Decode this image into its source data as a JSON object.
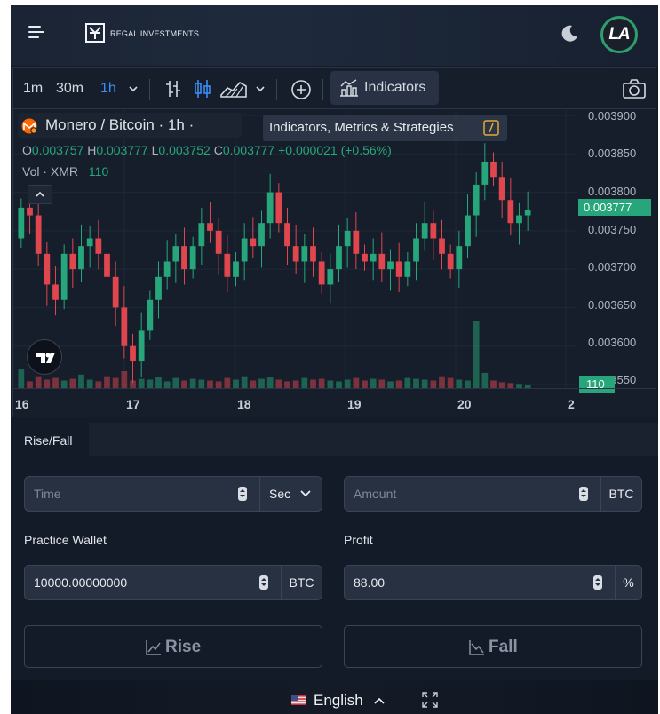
{
  "header": {
    "brand": "REGAL INVESTMENTS",
    "avatar_initials": "LA"
  },
  "toolbar": {
    "intervals": [
      "1m",
      "30m",
      "1h"
    ],
    "active_interval": "1h",
    "indicators_label": "Indicators"
  },
  "chart": {
    "symbol_title": "Monero / Bitcoin · 1h ·",
    "tooltip": "Indicators, Metrics & Strategies",
    "ohlc": {
      "o_label": "O",
      "o": "0.003757",
      "h_label": "H",
      "h": "0.003777",
      "l_label": "L",
      "l": "0.003752",
      "c_label": "C",
      "c": "0.003777",
      "change": "+0.000021 (+0.56%)"
    },
    "volume_label": "Vol · XMR",
    "volume_value": "110",
    "current_price": "0.003777",
    "volume_badge": "110"
  },
  "chart_data": {
    "type": "candlestick",
    "price_ticks": [
      "0.003900",
      "0.003850",
      "0.003800",
      "0.003750",
      "0.003700",
      "0.003650",
      "0.003600",
      "0.003550"
    ],
    "ylim": [
      0.00355,
      0.0039
    ],
    "time_ticks": [
      "16",
      "17",
      "18",
      "19",
      "20",
      "2"
    ],
    "colors": {
      "up": "#26a67a",
      "down": "#e0464d"
    },
    "closes": [
      0.00378,
      0.00377,
      0.00372,
      0.00368,
      0.00366,
      0.00372,
      0.0037,
      0.00373,
      0.00374,
      0.00372,
      0.00369,
      0.00365,
      0.0036,
      0.00358,
      0.00362,
      0.00366,
      0.00369,
      0.00371,
      0.00373,
      0.0037,
      0.00373,
      0.00376,
      0.00375,
      0.00372,
      0.00369,
      0.00371,
      0.00374,
      0.00373,
      0.00376,
      0.0038,
      0.00376,
      0.00373,
      0.00371,
      0.00373,
      0.00371,
      0.00368,
      0.0037,
      0.00373,
      0.00375,
      0.00372,
      0.00371,
      0.00372,
      0.0037,
      0.00371,
      0.00369,
      0.00371,
      0.00374,
      0.00376,
      0.00374,
      0.00372,
      0.0037,
      0.00373,
      0.00377,
      0.00381,
      0.00384,
      0.00382,
      0.00379,
      0.00376,
      0.00377,
      0.003777
    ],
    "volumes": [
      22,
      8,
      14,
      10,
      12,
      9,
      11,
      16,
      10,
      8,
      14,
      12,
      20,
      9,
      11,
      10,
      13,
      8,
      12,
      9,
      11,
      10,
      9,
      8,
      12,
      10,
      14,
      9,
      11,
      13,
      10,
      8,
      9,
      12,
      10,
      11,
      9,
      8,
      10,
      12,
      9,
      11,
      10,
      8,
      9,
      12,
      11,
      10,
      9,
      14,
      12,
      10,
      9,
      80,
      18,
      9,
      7,
      6,
      5,
      4
    ]
  },
  "trade": {
    "tab": "Rise/Fall",
    "time_placeholder": "Time",
    "time_unit": "Sec",
    "amount_placeholder": "Amount",
    "amount_currency": "BTC",
    "wallet_label": "Practice Wallet",
    "wallet_value": "10000.00000000",
    "wallet_currency": "BTC",
    "profit_label": "Profit",
    "profit_value": "88.00",
    "profit_unit": "%",
    "rise_label": "Rise",
    "fall_label": "Fall"
  },
  "footer": {
    "language": "English"
  }
}
